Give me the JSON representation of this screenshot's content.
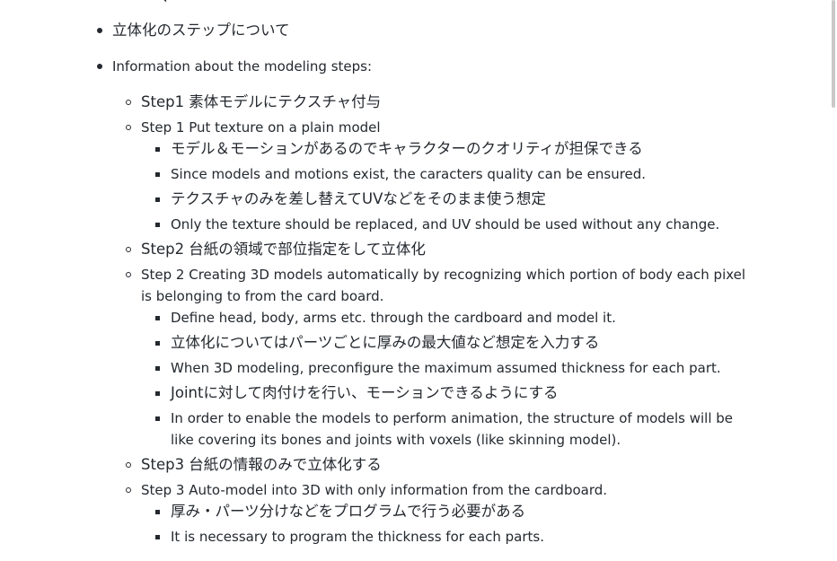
{
  "cut_top_text": "、             ",
  "items": [
    "立体化のステップについて",
    "Information about the modeling steps:",
    "Step1 素体モデルにテクスチャ付与",
    "Step 1 Put texture on a plain model",
    "モデル＆モーションがあるのでキャラクターのクオリティが担保できる",
    "Since models and motions exist, the caracters quality can be ensured.",
    "テクスチャのみを差し替えてUVなどをそのまま使う想定",
    "Only the texture should be replaced, and UV should be used without any change.",
    "Step2 台紙の領域で部位指定をして立体化",
    "Step 2 Creating 3D models automatically by recognizing which portion of body each pixel",
    "is belonging to from the card board.",
    "Define head, body, arms etc. through the cardboard and model it.",
    "立体化についてはパーツごとに厚みの最大値など想定を入力する",
    "When 3D modeling, preconfigure the maximum assumed thickness for each part.",
    "Jointに対して肉付けを行い、モーションできるようにする",
    "In order to enable the models to perform animation, the structure of models will be",
    "like covering its bones and joints with voxels (like skinning model).",
    "Step3 台紙の情報のみで立体化する",
    "Step 3 Auto-model into 3D with only information from the cardboard.",
    "厚み・パーツ分けなどをプログラムで行う必要がある",
    "It is necessary to program the thickness for each parts."
  ]
}
